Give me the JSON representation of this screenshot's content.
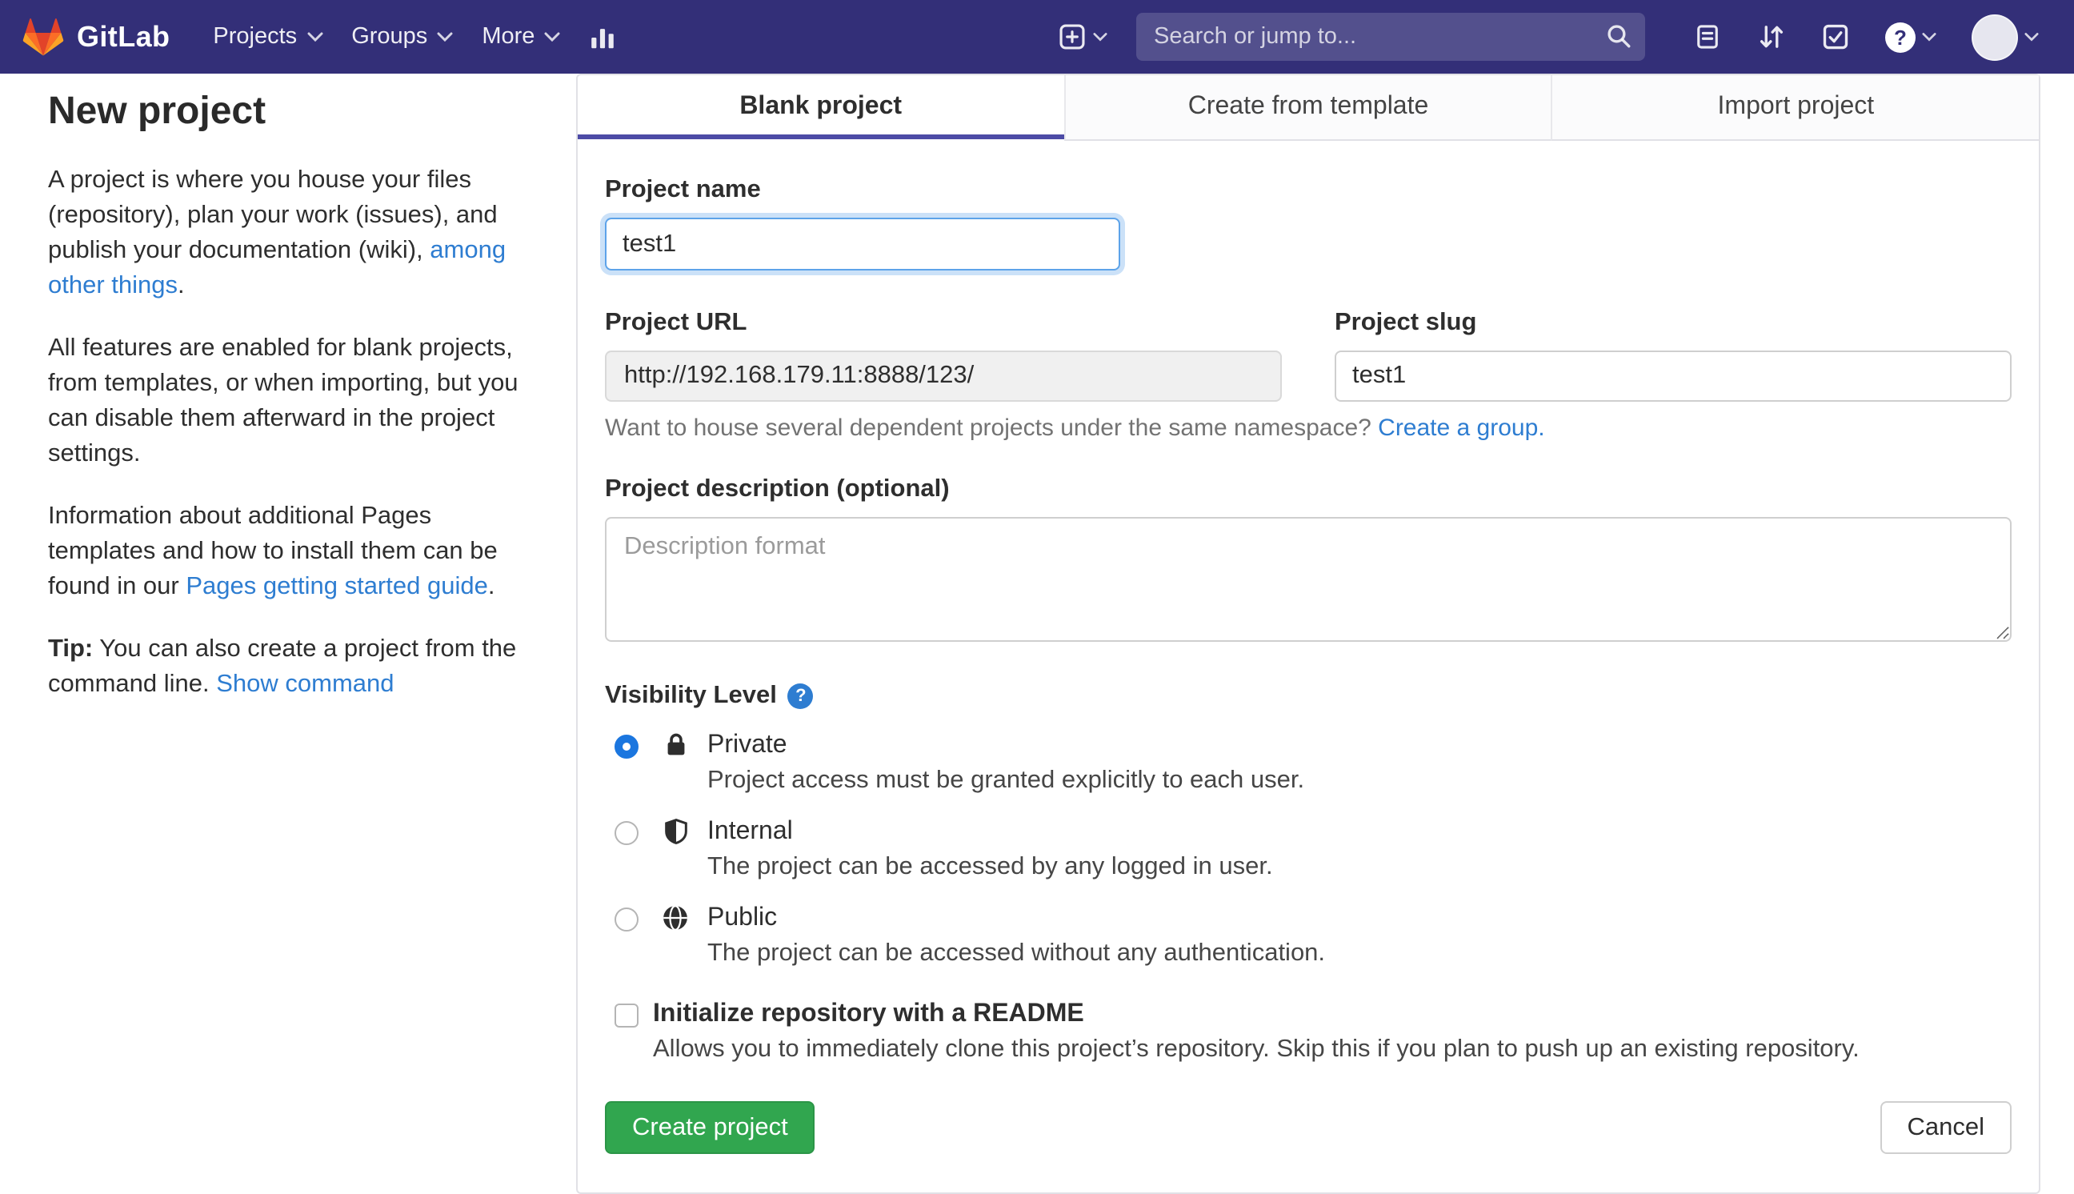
{
  "navbar": {
    "brand": "GitLab",
    "menu": {
      "projects": "Projects",
      "groups": "Groups",
      "more": "More"
    },
    "search": {
      "placeholder": "Search or jump to..."
    },
    "help_glyph": "?",
    "icon_names": [
      "tanuki-logo",
      "bar-chart",
      "plus-square",
      "issues",
      "merge-request",
      "todo-check",
      "help-question",
      "user-avatar"
    ]
  },
  "sidebar": {
    "title": "New project",
    "p1": {
      "pre": "A project is where you house your files (repository), plan your work (issues), and publish your documentation (wiki), ",
      "link": "among other things",
      "post": "."
    },
    "p2": "All features are enabled for blank projects, from templates, or when importing, but you can disable them afterward in the project settings.",
    "p3": {
      "pre": "Information about additional Pages templates and how to install them can be found in our ",
      "link": "Pages getting started guide",
      "post": "."
    },
    "tip": {
      "bold": "Tip:",
      "text": " You can also create a project from the command line. ",
      "link": "Show command"
    }
  },
  "tabs": [
    {
      "label": "Blank project",
      "active": true
    },
    {
      "label": "Create from template",
      "active": false
    },
    {
      "label": "Import project",
      "active": false
    }
  ],
  "form": {
    "name": {
      "label": "Project name",
      "value": "test1"
    },
    "url": {
      "label": "Project URL",
      "value": "http://192.168.179.11:8888/123/"
    },
    "slug": {
      "label": "Project slug",
      "value": "test1"
    },
    "namespace_help": {
      "pre": "Want to house several dependent projects under the same namespace? ",
      "link": "Create a group."
    },
    "description": {
      "label": "Project description (optional)",
      "placeholder": "Description format"
    },
    "visibility": {
      "label": "Visibility Level",
      "help_glyph": "?",
      "options": [
        {
          "name": "Private",
          "description": "Project access must be granted explicitly to each user.",
          "selected": true,
          "icon": "lock-icon"
        },
        {
          "name": "Internal",
          "description": "The project can be accessed by any logged in user.",
          "selected": false,
          "icon": "shield-icon"
        },
        {
          "name": "Public",
          "description": "The project can be accessed without any authentication.",
          "selected": false,
          "icon": "globe-icon"
        }
      ]
    },
    "readme": {
      "label": "Initialize repository with a README",
      "description": "Allows you to immediately clone this project’s repository. Skip this if you plan to push up an existing repository.",
      "checked": false
    },
    "submit_label": "Create project",
    "cancel_label": "Cancel"
  },
  "colors": {
    "navbar_bg": "#332f78",
    "active_tab_accent": "#4d4ba6",
    "link_blue": "#2e7dd1",
    "primary_green": "#31a64f",
    "radio_selected_blue": "#1b76df"
  }
}
